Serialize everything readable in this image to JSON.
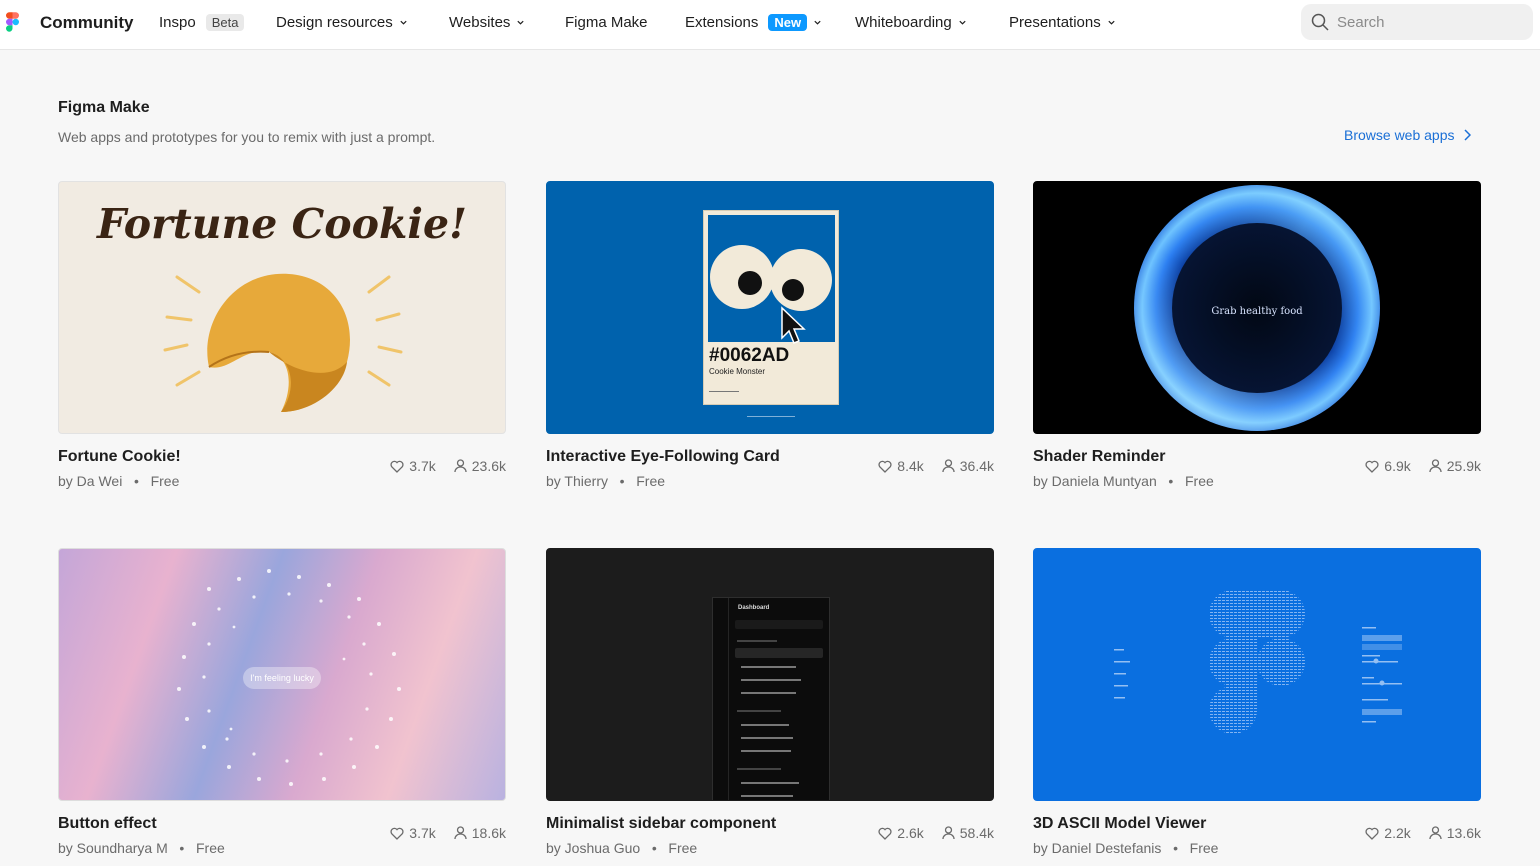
{
  "nav": {
    "brand": "Community",
    "items": [
      {
        "label": "Inspo",
        "badge": "Beta",
        "badge_style": "gray",
        "chevron": false
      },
      {
        "label": "Design resources",
        "chevron": true
      },
      {
        "label": "Websites",
        "chevron": true
      },
      {
        "label": "Figma Make",
        "chevron": false
      },
      {
        "label": "Extensions",
        "badge": "New",
        "badge_style": "blue",
        "chevron": true
      },
      {
        "label": "Whiteboarding",
        "chevron": true
      },
      {
        "label": "Presentations",
        "chevron": true
      }
    ],
    "search_placeholder": "Search"
  },
  "section": {
    "title": "Figma Make",
    "subtitle": "Web apps and prototypes for you to remix with just a prompt.",
    "browse_label": "Browse web apps"
  },
  "cards": [
    {
      "title": "Fortune Cookie!",
      "author": "by Da Wei",
      "price": "Free",
      "likes": "3.7k",
      "users": "23.6k",
      "thumb_text": "Fortune Cookie!"
    },
    {
      "title": "Interactive Eye-Following Card",
      "author": "by Thierry",
      "price": "Free",
      "likes": "8.4k",
      "users": "36.4k",
      "thumb_text": "#0062AD",
      "thumb_sub": "Cookie Monster"
    },
    {
      "title": "Shader Reminder",
      "author": "by Daniela Muntyan",
      "price": "Free",
      "likes": "6.9k",
      "users": "25.9k",
      "thumb_text": "Grab healthy food"
    },
    {
      "title": "Button effect",
      "author": "by Soundharya M",
      "price": "Free",
      "likes": "3.7k",
      "users": "18.6k",
      "thumb_text": "I'm feeling lucky"
    },
    {
      "title": "Minimalist sidebar component",
      "author": "by Joshua Guo",
      "price": "Free",
      "likes": "2.6k",
      "users": "58.4k",
      "thumb_text": "Dashboard"
    },
    {
      "title": "3D ASCII Model Viewer",
      "author": "by Daniel Destefanis",
      "price": "Free",
      "likes": "2.2k",
      "users": "13.6k"
    }
  ],
  "colors": {
    "accent_blue": "#0d99ff",
    "link_blue": "#1a6fd6",
    "cookie_monster_blue": "#0062AD"
  }
}
